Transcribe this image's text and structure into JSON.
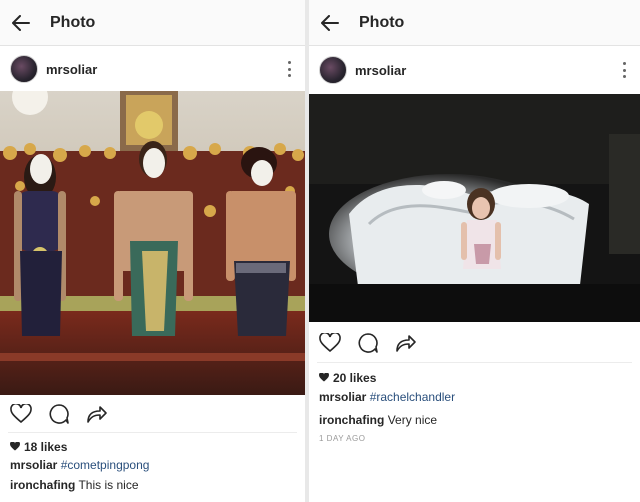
{
  "left": {
    "appbar_title": "Photo",
    "username": "mrsoliar",
    "likes": "18 likes",
    "caption": {
      "user": "mrsoliar",
      "tag": "#cometpingpong"
    },
    "comment": {
      "user": "ironchafing",
      "text": "This is nice"
    }
  },
  "right": {
    "appbar_title": "Photo",
    "username": "mrsoliar",
    "likes": "20 likes",
    "caption": {
      "user": "mrsoliar",
      "tag": "#rachelchandler"
    },
    "comment": {
      "user": "ironchafing",
      "text": "Very nice"
    },
    "timestamp": "1 DAY AGO"
  },
  "icons": [
    "back-arrow-icon",
    "more-options-icon",
    "heart-icon",
    "comment-icon",
    "share-icon",
    "likes-heart-icon"
  ],
  "colors": {
    "hashtag": "#2a4f7c",
    "text": "#262626",
    "meta": "#9a9a9a",
    "appbar": "#fafafa"
  }
}
